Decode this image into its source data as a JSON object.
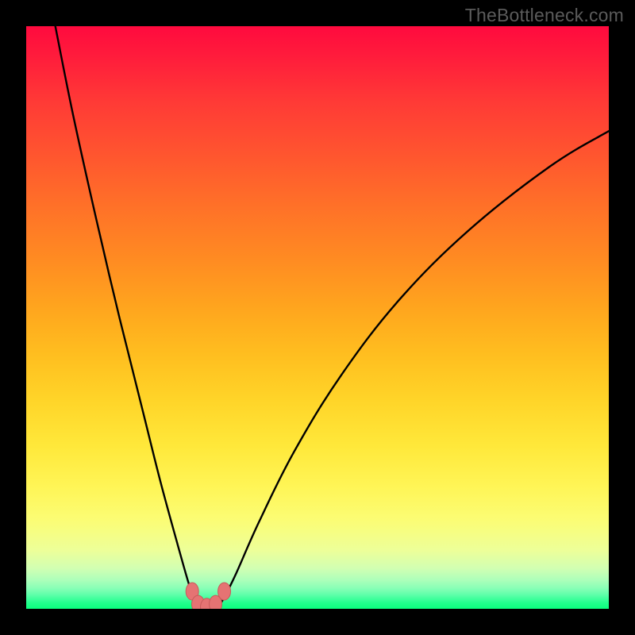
{
  "watermark": "TheBottleneck.com",
  "colors": {
    "frame": "#000000",
    "curve_stroke": "#000000",
    "marker_fill": "#e57373",
    "marker_stroke": "#c85b5b",
    "gradient_top": "#ff0a3e",
    "gradient_bottom": "#0aff7e"
  },
  "chart_data": {
    "type": "line",
    "title": "",
    "xlabel": "",
    "ylabel": "",
    "xlim": [
      0,
      100
    ],
    "ylim": [
      0,
      100
    ],
    "grid": false,
    "legend": false,
    "description": "V-shaped bottleneck curve over a vertical spectral gradient (red=high bottleneck, green=low). Minimum of the curve lies around x≈29–33 at y≈0–3.",
    "series": [
      {
        "name": "bottleneck-curve",
        "x": [
          5,
          8,
          12,
          16,
          20,
          23,
          26,
          28,
          29,
          30,
          31,
          32,
          33,
          34,
          36,
          40,
          46,
          54,
          64,
          76,
          90,
          100
        ],
        "y": [
          100,
          85,
          67,
          50,
          34,
          22,
          11,
          4,
          1.5,
          0.5,
          0.2,
          0.2,
          0.5,
          2,
          6,
          15,
          27,
          40,
          53,
          65,
          76,
          82
        ]
      }
    ],
    "markers": [
      {
        "name": "min-marker-left",
        "x": 28.5,
        "y": 3.0
      },
      {
        "name": "min-marker-mid-1",
        "x": 29.5,
        "y": 0.8
      },
      {
        "name": "min-marker-mid-2",
        "x": 31.0,
        "y": 0.3
      },
      {
        "name": "min-marker-mid-3",
        "x": 32.5,
        "y": 0.8
      },
      {
        "name": "min-marker-right",
        "x": 34.0,
        "y": 3.0
      }
    ]
  }
}
